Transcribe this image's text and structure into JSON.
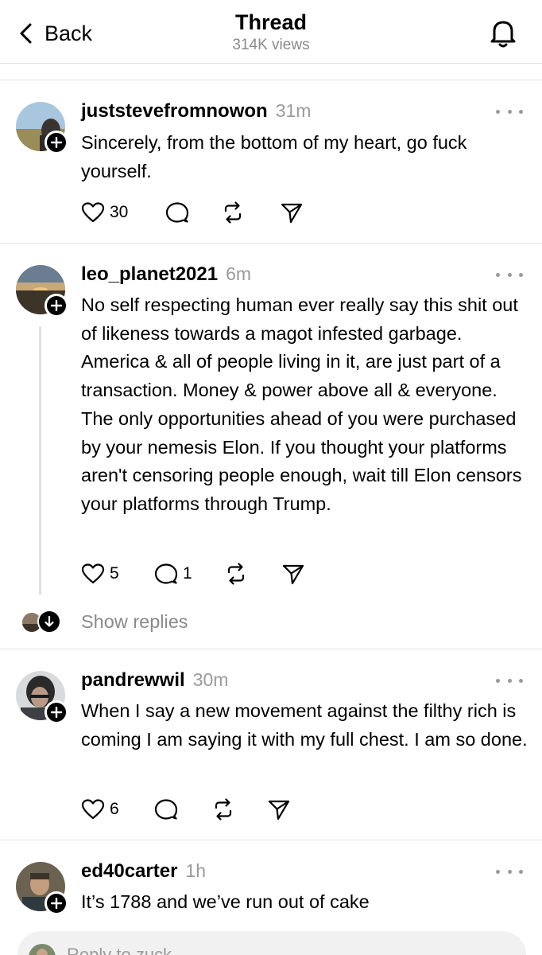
{
  "header": {
    "back_label": "Back",
    "title": "Thread",
    "views": "314K views"
  },
  "posts": [
    {
      "username": "juststevefromnowon",
      "time": "31m",
      "text": "Sincerely, from the bottom of my heart, go fuck yourself.",
      "likes": "30",
      "replies": "",
      "reposts": ""
    },
    {
      "username": "leo_planet2021",
      "time": "6m",
      "text": "No self respecting human ever really say this shit out of likeness towards a magot infested garbage. America & all of people living in it, are just part of a transaction. Money & power above all & everyone. The only opportunities ahead of you were purchased by your nemesis Elon. If you thought your platforms aren't censoring people enough, wait till Elon censors your platforms through Trump.",
      "likes": "5",
      "replies": "1",
      "reposts": ""
    },
    {
      "username": "pandrewwil",
      "time": "30m",
      "text": "When I say a new movement against the filthy rich is coming I am saying it with my full chest. I am so done.",
      "likes": "6",
      "replies": "",
      "reposts": ""
    },
    {
      "username": "ed40carter",
      "time": "1h",
      "text": "It’s 1788 and we’ve run out of cake",
      "likes": "",
      "replies": "",
      "reposts": ""
    }
  ],
  "show_replies_label": "Show replies",
  "reply_bar": {
    "placeholder": "Reply to zuck..."
  },
  "icons": {
    "back": "chevron-left-icon",
    "notifications": "bell-icon",
    "like": "heart-icon",
    "reply": "comment-bubble-icon",
    "repost": "repost-icon",
    "share": "send-icon",
    "more": "more-dots-icon",
    "follow": "plus-icon"
  }
}
